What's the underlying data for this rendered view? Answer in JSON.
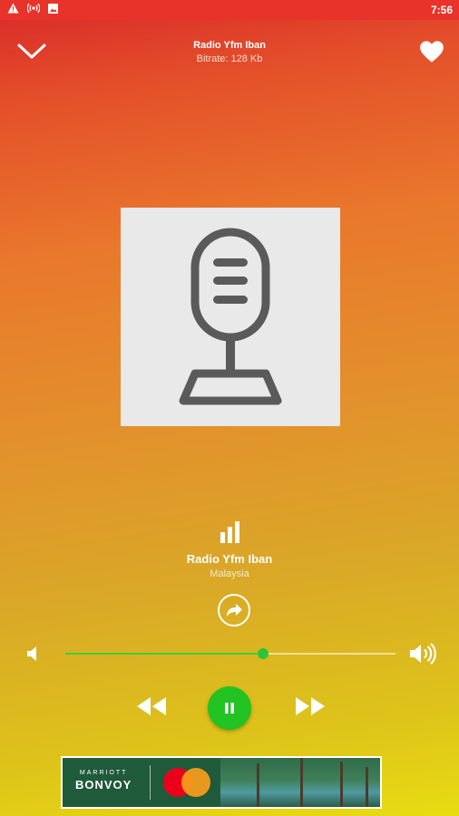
{
  "status_bar": {
    "time": "7:56",
    "icons": [
      "warning-icon",
      "broadcast-icon",
      "image-icon"
    ]
  },
  "top_bar": {
    "title": "Radio Yfm Iban",
    "subtitle": "Bitrate: 128 Kb",
    "icons": [
      "chevron-down-icon",
      "heart-icon"
    ]
  },
  "artwork": {
    "icon": "microphone-icon"
  },
  "station": {
    "name": "Radio Yfm Iban",
    "country": "Malaysia",
    "icons": [
      "equalizer-icon",
      "share-icon"
    ]
  },
  "volume": {
    "level": 0.6,
    "icons": [
      "volume-low-icon",
      "volume-high-icon"
    ]
  },
  "controls": {
    "state": "playing",
    "icons": [
      "rewind-icon",
      "pause-icon",
      "fast-forward-icon"
    ],
    "accent_color": "#22c322"
  },
  "ad": {
    "brand_small": "MARRIOTT",
    "brand_large": "BONVOY",
    "partner_logo": "mastercard-logo"
  }
}
